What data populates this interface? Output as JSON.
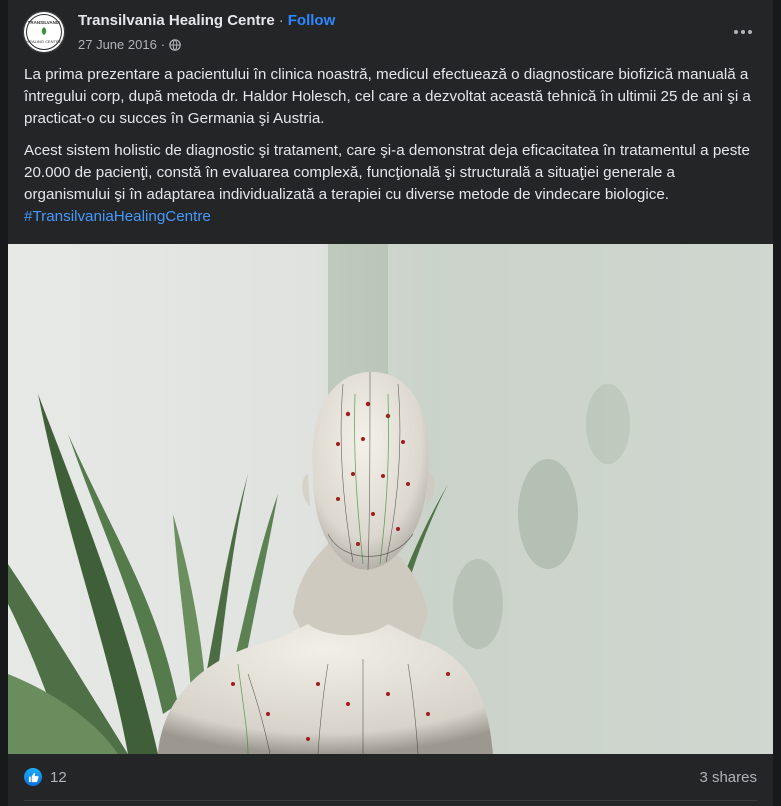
{
  "post": {
    "page_name": "Transilvania Healing Centre",
    "separator": "·",
    "follow_label": "Follow",
    "date": "27 June 2016",
    "date_separator": "·",
    "paragraph_1": "La prima prezentare a pacientului în clinica noastră, medicul efectuează o diagnosticare biofizică manuală a întregului corp, după metoda dr. Haldor Holesch, cel care a dezvoltat această tehnică în ultimii 25 de ani şi a practicat-o cu succes în Germania şi Austria.",
    "paragraph_2": "Acest sistem holistic de diagnostic şi tratament, care şi-a demonstrat deja eficacitatea în tratamentul a peste 20.000 de pacienţi, constă în evaluarea complexă, funcţională şi structurală a situaţiei generale a organismului şi în adaptarea individualizată a terapiei cu diverse metode de vindecare biologice.",
    "hashtag": "#TransilvaniaHealingCentre"
  },
  "avatar": {
    "logo_top_text": "TRANSILVANIA",
    "logo_bottom_text": "HEALING CENTRE"
  },
  "footer": {
    "like_count": "12",
    "shares": "3 shares"
  },
  "icons": {
    "privacy": "globe-icon",
    "more": "more-horizontal-icon",
    "reaction": "like-reaction-icon"
  },
  "colors": {
    "background": "#242526",
    "text": "#e4e6eb",
    "secondary": "#b0b3b8",
    "link": "#2d88ff",
    "hashtag": "#4599ff"
  }
}
